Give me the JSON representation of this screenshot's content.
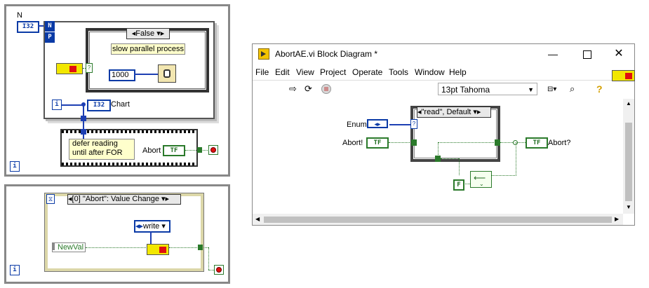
{
  "left_top": {
    "n_label": "N",
    "i32": "I32",
    "n_term": "N",
    "p_term": "P",
    "case_selector": "False",
    "case_comment": "slow parallel process",
    "constant": "1000",
    "i_term": "i",
    "chart_i32": "I32",
    "chart_label": "Chart",
    "seq_comment": "defer reading\nuntil after FOR",
    "abort_label": "Abort",
    "tf": "TF",
    "i_term2": "i"
  },
  "left_bottom": {
    "event_case": "[0] \"Abort\": Value Change",
    "write_selector": "write",
    "newval_label": "NewVal",
    "i_term": "i"
  },
  "window": {
    "title": "AbortAE.vi Block Diagram *",
    "menu": [
      "File",
      "Edit",
      "View",
      "Project",
      "Operate",
      "Tools",
      "Window",
      "Help"
    ],
    "font_select": "13pt Tahoma",
    "enum_label": "Enum",
    "enum_term": "◂▸",
    "abort_in_label": "Abort!",
    "tf": "TF",
    "case_selector": "\"read\", Default",
    "abort_out_label": "Abort?",
    "false_const": "F",
    "question": "?"
  },
  "colors": {
    "accent_blue": "#1d3fb3",
    "bool_green": "#2b7a2b",
    "fgv_yellow": "#f2e700",
    "fgv_red": "#e01010"
  }
}
